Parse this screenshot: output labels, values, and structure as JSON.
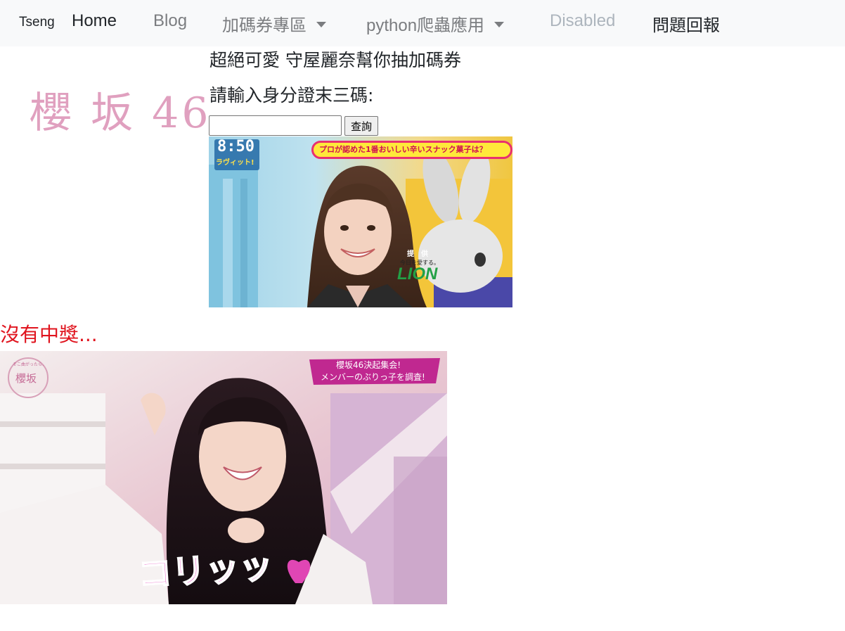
{
  "navbar": {
    "brand": "Tseng",
    "items": [
      {
        "label": "Home"
      },
      {
        "label": "Blog"
      },
      {
        "label": "加碼券專區"
      },
      {
        "label": "python爬蟲應用"
      },
      {
        "label": "Disabled"
      },
      {
        "label": "問題回報"
      }
    ]
  },
  "logo": {
    "text": "櫻 坂 46"
  },
  "main": {
    "headline": "超絕可愛 守屋麗奈幫你抽加碼券",
    "prompt": "請輸入身分證末三碼:",
    "input_value": "",
    "query_button": "查詢",
    "result_text": "沒有中獎..."
  },
  "photo1": {
    "clock": "8:50",
    "clock_sub": "ラヴィット!",
    "banner": "プロが認めた1番おいしい辛いスナック菓子は？",
    "sponsor_small": "提　供",
    "sponsor_tag": "今日を愛する。",
    "sponsor": "LION"
  },
  "photo2": {
    "corner_logo": "櫻坂",
    "corner_logo_sub": "そこ曲がったら、",
    "banner_line1": "櫻坂46決起集会!",
    "banner_line2": "メンバーのぶりっ子を調査!",
    "caption": "コリッッ"
  },
  "colors": {
    "navbar_bg": "#f8f9fa",
    "logo": "#e0a0bf",
    "result": "#e0141e"
  }
}
